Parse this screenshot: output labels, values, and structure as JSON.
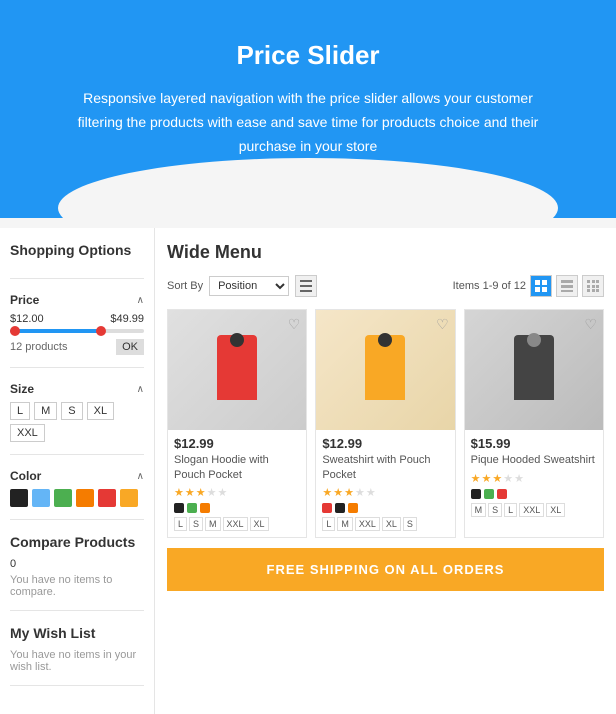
{
  "hero": {
    "title": "Price Slider",
    "description": "Responsive layered navigation with the price slider allows your customer filtering the products with ease and save time for products choice and their purchase in your store"
  },
  "sidebar": {
    "shopping_options_label": "Shopping Options",
    "price_section": {
      "label": "Price",
      "min": "$12.00",
      "max": "$49.99",
      "products_count": "12 products",
      "ok_btn": "OK"
    },
    "size_section": {
      "label": "Size",
      "options": [
        "L",
        "M",
        "S",
        "XL",
        "XXL"
      ]
    },
    "color_section": {
      "label": "Color",
      "swatches": [
        {
          "color": "#222222"
        },
        {
          "color": "#64B5F6"
        },
        {
          "color": "#4CAF50"
        },
        {
          "color": "#F57C00"
        },
        {
          "color": "#e53935"
        },
        {
          "color": "#F9A825"
        }
      ]
    },
    "compare_section": {
      "label": "Compare Products",
      "count": "0",
      "note": "You have no items to compare."
    },
    "wishlist_section": {
      "label": "My Wish List",
      "note": "You have no items in your wish list."
    }
  },
  "content": {
    "title": "Wide Menu",
    "toolbar": {
      "sort_label": "Sort By",
      "sort_value": "Position",
      "items_label": "Items 1-9 of 12"
    },
    "products": [
      {
        "price": "$12.99",
        "name": "Slogan Hoodie with Pouch Pocket",
        "stars": 3,
        "colors": [
          "#222",
          "#4CAF50",
          "#F57C00"
        ],
        "sizes": [
          "L",
          "S",
          "M",
          "XXL",
          "XL"
        ],
        "img_type": "red"
      },
      {
        "price": "$12.99",
        "name": "Sweatshirt with Pouch Pocket",
        "stars": 3,
        "colors": [
          "#e53935",
          "#222",
          "#F57C00"
        ],
        "sizes": [
          "L",
          "M",
          "XXL",
          "XL",
          "S"
        ],
        "img_type": "yellow"
      },
      {
        "price": "$15.99",
        "name": "Pique Hooded Sweatshirt",
        "stars": 3,
        "colors": [
          "#222",
          "#4CAF50",
          "#e53935"
        ],
        "sizes": [
          "M",
          "S",
          "L",
          "XXL",
          "XL"
        ],
        "img_type": "dark"
      }
    ],
    "banner": {
      "text": "FREE SHIPPING ON ALL ORDERS"
    }
  }
}
